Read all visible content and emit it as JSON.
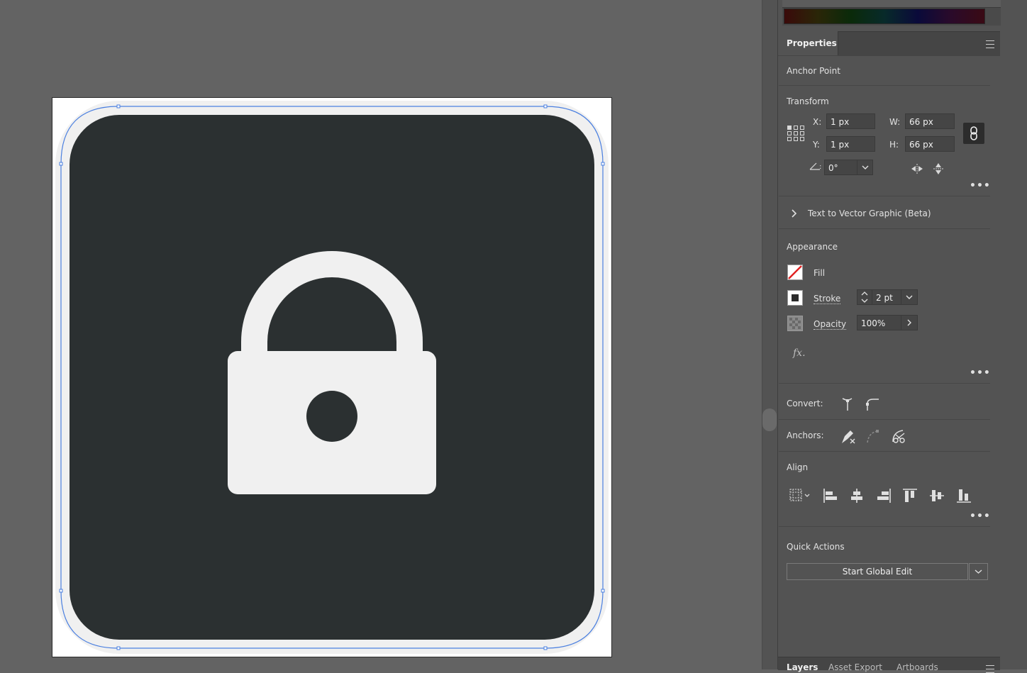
{
  "properties_panel": {
    "tab_label": "Properties",
    "selection_type": "Anchor Point",
    "transform": {
      "heading": "Transform",
      "x_label": "X:",
      "x_value": "1 px",
      "y_label": "Y:",
      "y_value": "1 px",
      "w_label": "W:",
      "w_value": "66 px",
      "h_label": "H:",
      "h_value": "66 px",
      "rotate_value": "0°"
    },
    "text_to_vector": "Text to Vector Graphic (Beta)",
    "appearance": {
      "heading": "Appearance",
      "fill_label": "Fill",
      "stroke_label": "Stroke",
      "stroke_value": "2 pt",
      "opacity_label": "Opacity",
      "opacity_value": "100%",
      "fx_label": "fx."
    },
    "convert_label": "Convert:",
    "anchors_label": "Anchors:",
    "align_heading": "Align",
    "quick_actions": {
      "heading": "Quick Actions",
      "global_edit_button": "Start Global Edit"
    }
  },
  "bottom_tabs": [
    "Layers",
    "Asset Export",
    "Artboards"
  ],
  "artwork": {
    "icon_name": "lock-icon",
    "background_color": "#2b3031",
    "foreground_color": "#f0f0f0",
    "selection_color": "#4a7fe0"
  },
  "colors": {
    "panel_bg": "#535353",
    "canvas_bg": "#636363"
  }
}
